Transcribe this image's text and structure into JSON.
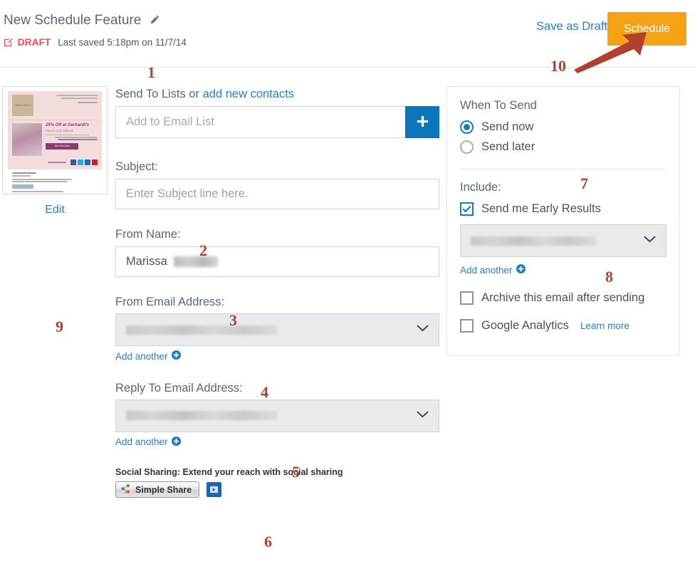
{
  "header": {
    "title": "New Schedule Feature",
    "edit_title_icon": "pencil-icon",
    "draft_icon": "draft-edit-icon",
    "draft_badge": "DRAFT",
    "last_saved": "Last saved 5:18pm on 11/7/14",
    "save_as_draft": "Save as Draft",
    "schedule_button": "Schedule",
    "schedule_button_color": "#f5a315"
  },
  "preview": {
    "edit_link": "Edit",
    "thumb": {
      "brand": "GREAT DEALS",
      "headline": "25% Off at Gerhardt's",
      "subhead": "Classic and Tailored",
      "cta": "Get This Deal",
      "social_label": "stay connected"
    }
  },
  "form": {
    "send_to_label": "Send To Lists or ",
    "add_new_contacts_link": "add new contacts",
    "list_placeholder": "Add to Email List",
    "list_value": "",
    "add_list_icon": "plus-icon",
    "subject_label": "Subject:",
    "subject_placeholder": "Enter Subject line here.",
    "subject_value": "",
    "from_name_label": "From Name:",
    "from_name_value": "Marissa",
    "from_email_label": "From Email Address:",
    "from_email_value": "",
    "reply_to_label": "Reply To Email Address:",
    "reply_to_value": "",
    "add_another": "Add another",
    "add_another_icon": "circle-plus-icon",
    "dropdown_icon": "chevron-down-icon",
    "social_label": "Social Sharing: Extend your reach with social sharing",
    "simple_share_button": "Simple Share",
    "simple_share_icon": "share-nodes-icon",
    "video_button_icon": "play-video-icon"
  },
  "right_panel": {
    "when_to_send_title": "When To Send",
    "send_now": "Send now",
    "send_later": "Send later",
    "send_now_selected": true,
    "include_title": "Include:",
    "early_results": "Send me Early Results",
    "early_results_checked": true,
    "early_results_recipient": "",
    "add_another": "Add another",
    "archive_label": "Archive this email after sending",
    "archive_checked": false,
    "google_analytics_label": "Google Analytics",
    "learn_more": "Learn more",
    "google_analytics_checked": false
  },
  "annotations": {
    "a1": "1",
    "a2": "2",
    "a3": "3",
    "a4": "4",
    "a5": "5",
    "a6": "6",
    "a7": "7",
    "a8": "8",
    "a9": "9",
    "a10": "10",
    "color": "#b2402c"
  }
}
